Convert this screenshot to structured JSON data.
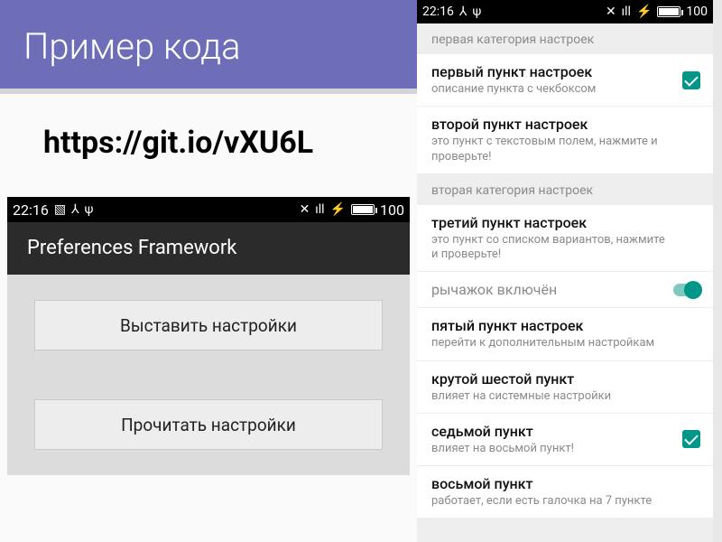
{
  "slide": {
    "title": "Пример кода",
    "url": "https://git.io/vXU6L"
  },
  "status_bar": {
    "time": "22:16",
    "battery": "100"
  },
  "left_app": {
    "app_bar_title": "Preferences Framework",
    "btn1": "Выставить настройки",
    "btn2": "Прочитать настройки"
  },
  "settings": {
    "cat1": "первая категория настроек",
    "cat2": "вторая категория настроек",
    "items": [
      {
        "title": "первый пункт настроек",
        "summary": "описание пункта с чекбоксом"
      },
      {
        "title": "второй пункт настроек",
        "summary": "это пункт с текстовым полем, нажмите и проверьте!"
      },
      {
        "title": "третий пункт настроек",
        "summary": "это пункт со списком вариантов, нажмите и проверьте!"
      },
      {
        "title": "рычажок включён",
        "summary": ""
      },
      {
        "title": "пятый пункт настроек",
        "summary": "перейти к дополнительным настройкам"
      },
      {
        "title": "крутой шестой пункт",
        "summary": "влияет на системные настройки"
      },
      {
        "title": "седьмой пункт",
        "summary": "влияет на восьмой пункт!"
      },
      {
        "title": "восьмой пункт",
        "summary": "работает, если есть галочка на 7 пункте"
      }
    ]
  }
}
